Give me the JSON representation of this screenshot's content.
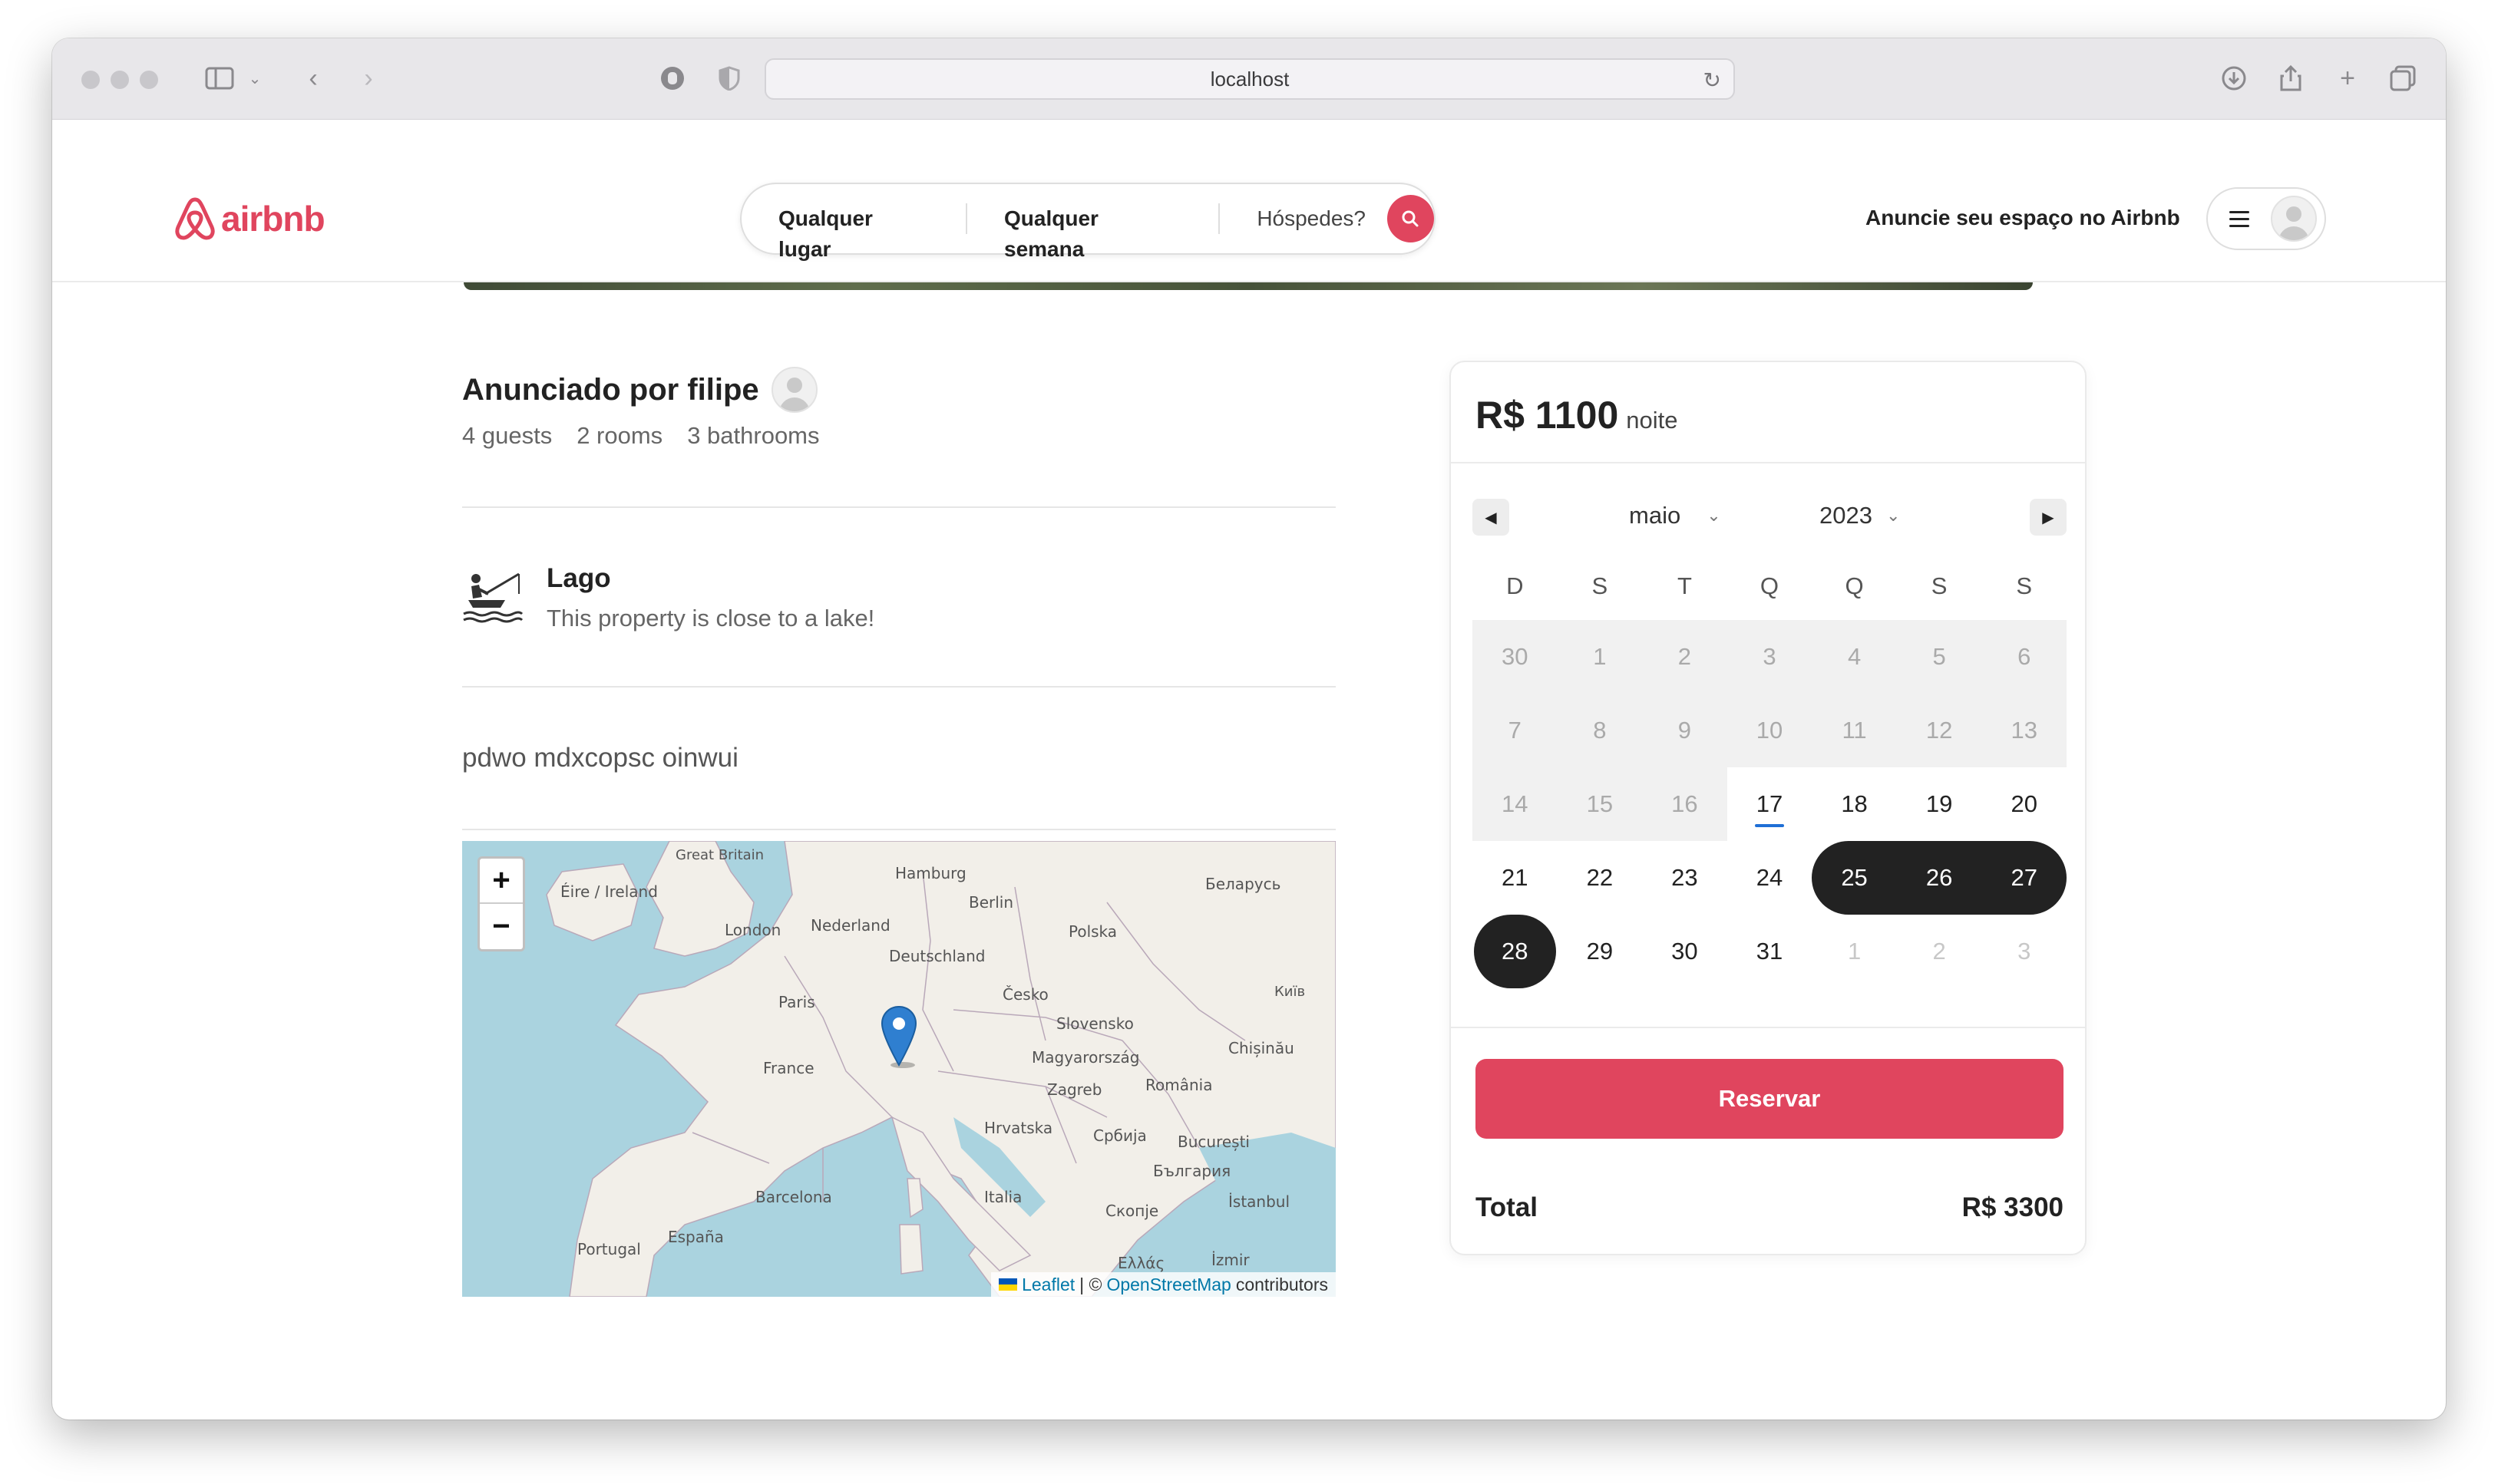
{
  "browser": {
    "url": "localhost"
  },
  "header": {
    "logo_text": "airbnb",
    "search": {
      "place": "Qualquer lugar",
      "week": "Qualquer semana",
      "guests": "Hóspedes?"
    },
    "host_link": "Anuncie seu espaço no Airbnb"
  },
  "listing": {
    "host_title": "Anunciado por filipe",
    "stats": {
      "guests": "4 guests",
      "rooms": "2 rooms",
      "bathrooms": "3 bathrooms"
    },
    "amenity": {
      "icon": "fishing-lake-icon",
      "title": "Lago",
      "description": "This property is close to a lake!"
    },
    "description": "pdwo mdxcopsc oinwui"
  },
  "map": {
    "zoom_in": "+",
    "zoom_out": "−",
    "attribution": {
      "leaflet": "Leaflet",
      "separator": "| ©",
      "osm": "OpenStreetMap",
      "suffix": "contributors"
    },
    "labels": [
      "Great Britain",
      "Éire / Ireland",
      "Hamburg",
      "Беларусь",
      "Berlin",
      "London",
      "Nederland",
      "Polska",
      "Deutschland",
      "Paris",
      "Česko",
      "Київ",
      "Slovensko",
      "France",
      "Magyarország",
      "Chișinău",
      "Zagreb",
      "România",
      "Hrvatska",
      "Србија",
      "București",
      "Barcelona",
      "България",
      "Italia",
      "Скопје",
      "İstanbul",
      "España",
      "Portugal",
      "Ελλάς",
      "İzmir"
    ]
  },
  "booking": {
    "price": "R$ 1100",
    "price_unit": "noite",
    "month": "maio",
    "year": "2023",
    "weekdays": [
      "D",
      "S",
      "T",
      "Q",
      "Q",
      "S",
      "S"
    ],
    "days": [
      {
        "n": "30",
        "s": "past"
      },
      {
        "n": "1",
        "s": "past"
      },
      {
        "n": "2",
        "s": "past"
      },
      {
        "n": "3",
        "s": "past"
      },
      {
        "n": "4",
        "s": "past"
      },
      {
        "n": "5",
        "s": "past"
      },
      {
        "n": "6",
        "s": "past"
      },
      {
        "n": "7",
        "s": "past"
      },
      {
        "n": "8",
        "s": "past"
      },
      {
        "n": "9",
        "s": "past"
      },
      {
        "n": "10",
        "s": "past"
      },
      {
        "n": "11",
        "s": "past"
      },
      {
        "n": "12",
        "s": "past"
      },
      {
        "n": "13",
        "s": "past"
      },
      {
        "n": "14",
        "s": "past"
      },
      {
        "n": "15",
        "s": "past"
      },
      {
        "n": "16",
        "s": "past"
      },
      {
        "n": "17",
        "s": "today"
      },
      {
        "n": "18",
        "s": ""
      },
      {
        "n": "19",
        "s": ""
      },
      {
        "n": "20",
        "s": ""
      },
      {
        "n": "21",
        "s": ""
      },
      {
        "n": "22",
        "s": ""
      },
      {
        "n": "23",
        "s": ""
      },
      {
        "n": "24",
        "s": ""
      },
      {
        "n": "25",
        "s": "range range-start"
      },
      {
        "n": "26",
        "s": "range"
      },
      {
        "n": "27",
        "s": "range range-end"
      },
      {
        "n": "28",
        "s": "single"
      },
      {
        "n": "29",
        "s": ""
      },
      {
        "n": "30",
        "s": ""
      },
      {
        "n": "31",
        "s": ""
      },
      {
        "n": "1",
        "s": "other"
      },
      {
        "n": "2",
        "s": "other"
      },
      {
        "n": "3",
        "s": "other"
      }
    ],
    "reserve_label": "Reservar",
    "total_label": "Total",
    "total_value": "R$ 3300"
  },
  "colors": {
    "brand": "#e0455e",
    "selected": "#222222",
    "today_underline": "#1f6fd6"
  }
}
